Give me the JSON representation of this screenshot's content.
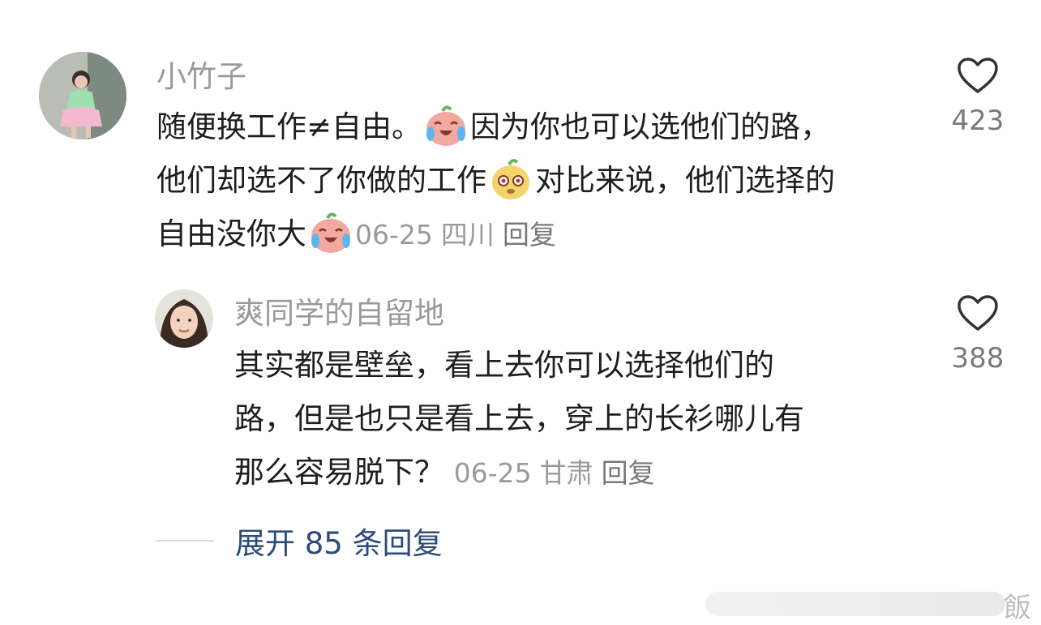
{
  "comment": {
    "username": "小竹子",
    "lines": [
      "随便换工作≠自由。",
      "因为你也可以选他们的路，",
      "他们却选不了你做的工作",
      "对比来说，他们选择的",
      "自由没你大"
    ],
    "date": "06-25",
    "location": "四川",
    "reply_label": "回复",
    "likes": "423"
  },
  "reply": {
    "username": "爽同学的自留地",
    "lines": [
      "其实都是壁垒，看上去你可以选择他们的",
      "路，但是也只是看上去，穿上的长衫哪儿有",
      "那么容易脱下？"
    ],
    "date": "06-25",
    "location": "甘肃",
    "reply_label": "回复",
    "likes": "388"
  },
  "expand_label": "展开 85 条回复",
  "watermark": "飯",
  "emojis": [
    "laugh-cry-peach-icon",
    "dizzy-pear-icon",
    "laugh-cry-peach-icon"
  ]
}
